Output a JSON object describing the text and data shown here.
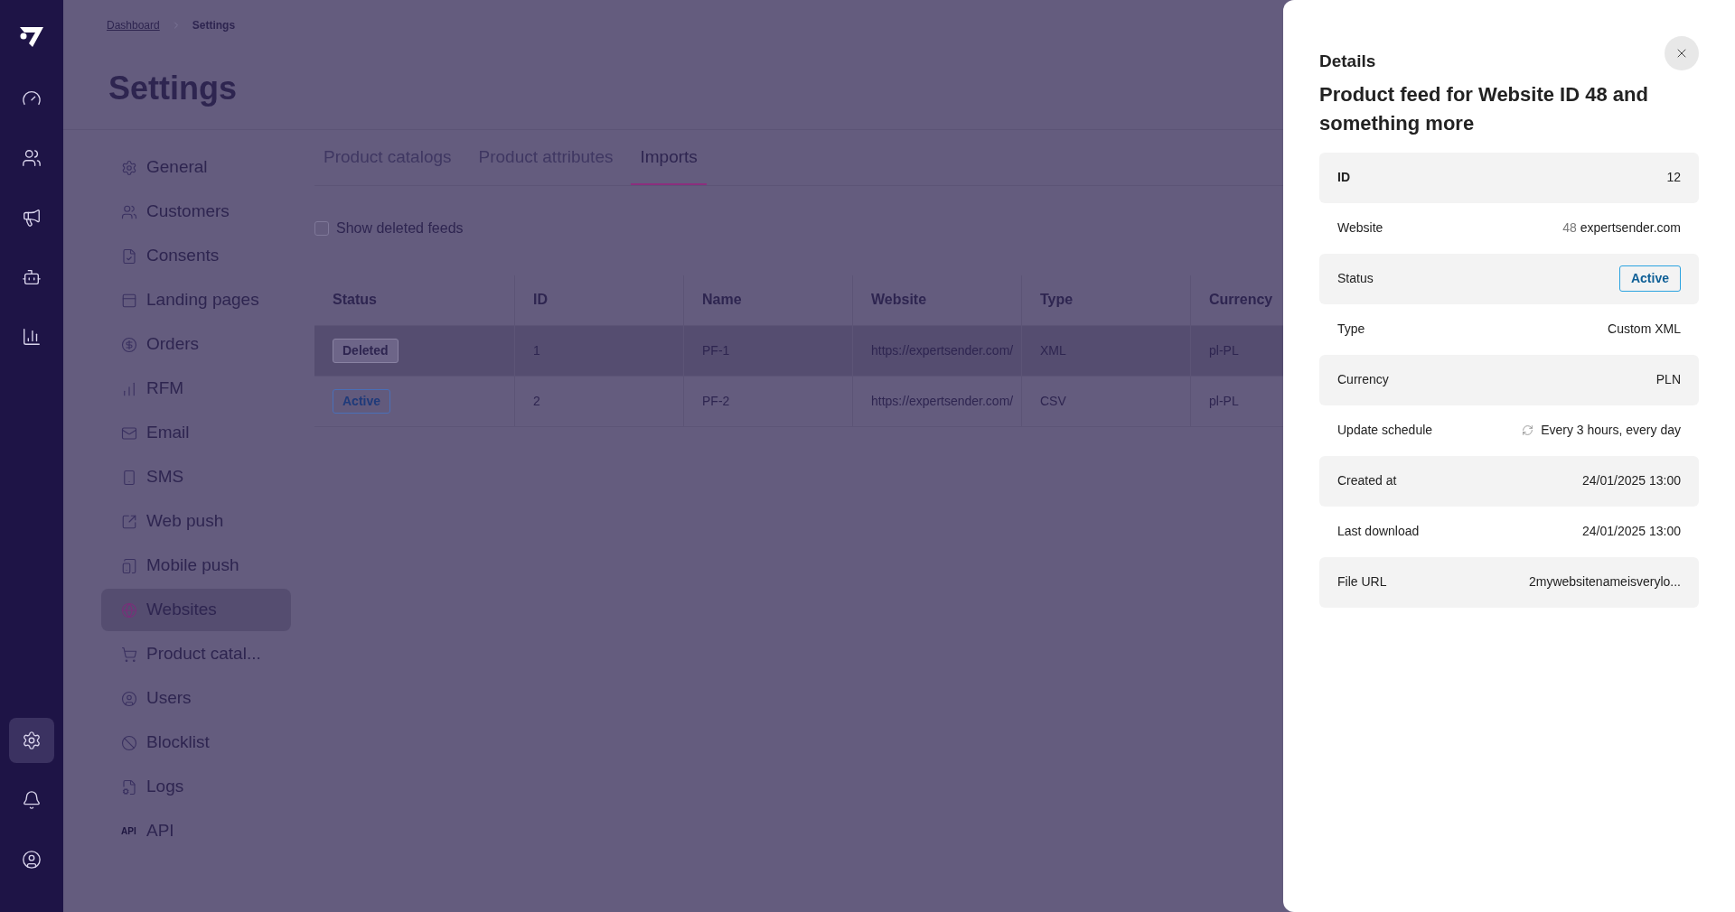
{
  "nav_rail": {
    "top_items": [
      {
        "selected": false
      },
      {
        "selected": false
      },
      {
        "selected": false
      },
      {
        "selected": false
      },
      {
        "selected": false
      }
    ],
    "bottom_items": [
      {
        "selected": true
      },
      {
        "selected": false
      },
      {
        "selected": false
      }
    ]
  },
  "breadcrumb": [
    "Dashboard",
    "Settings"
  ],
  "page_title": "Settings",
  "settings_menu": [
    {
      "label": "General",
      "selected": false
    },
    {
      "label": "Customers",
      "selected": false
    },
    {
      "label": "Consents",
      "selected": false
    },
    {
      "label": "Landing pages",
      "selected": false
    },
    {
      "label": "Orders",
      "selected": false
    },
    {
      "label": "RFM",
      "selected": false
    },
    {
      "label": "Email",
      "selected": false
    },
    {
      "label": "SMS",
      "selected": false
    },
    {
      "label": "Web push",
      "selected": false
    },
    {
      "label": "Mobile push",
      "selected": false
    },
    {
      "label": "Websites",
      "selected": true
    },
    {
      "label": "Product catal...",
      "selected": false
    },
    {
      "label": "Users",
      "selected": false
    },
    {
      "label": "Blocklist",
      "selected": false
    },
    {
      "label": "Logs",
      "selected": false
    },
    {
      "label": "API",
      "selected": false,
      "icon_text": "API"
    }
  ],
  "tabs": [
    {
      "label": "Product catalogs",
      "selected": false
    },
    {
      "label": "Product attributes",
      "selected": false
    },
    {
      "label": "Imports",
      "selected": true
    }
  ],
  "show_deleted": {
    "label": "Show deleted feeds",
    "checked": false
  },
  "table": {
    "columns": [
      "Status",
      "ID",
      "Name",
      "Website",
      "Type",
      "Currency"
    ],
    "rows": [
      {
        "highlighted": true,
        "cells": [
          {
            "kind": "deleted",
            "text": "Deleted"
          },
          {
            "kind": "text",
            "text": "1"
          },
          {
            "kind": "text",
            "text": "PF-1"
          },
          {
            "kind": "text",
            "text": "https://expertsender.com/"
          },
          {
            "kind": "text",
            "text": "XML"
          },
          {
            "kind": "text",
            "text": "pl-PL"
          }
        ]
      },
      {
        "highlighted": false,
        "cells": [
          {
            "kind": "active",
            "text": "Active"
          },
          {
            "kind": "text",
            "text": "2"
          },
          {
            "kind": "text",
            "text": "PF-2"
          },
          {
            "kind": "text",
            "text": "https://expertsender.com/"
          },
          {
            "kind": "text",
            "text": "CSV"
          },
          {
            "kind": "text",
            "text": "pl-PL"
          }
        ]
      }
    ]
  },
  "details": {
    "heading": "Details",
    "title": "Product feed for Website ID 48 and something more",
    "rows": [
      {
        "kind": "bold",
        "label": "ID",
        "value": "12"
      },
      {
        "kind": "text",
        "label": "Website",
        "prefix": "48",
        "value": "expertsender.com"
      },
      {
        "kind": "badge",
        "label": "Status",
        "value": "Active"
      },
      {
        "kind": "text",
        "label": "Type",
        "value": "Custom XML"
      },
      {
        "kind": "text",
        "label": "Currency",
        "value": "PLN"
      },
      {
        "kind": "schedule",
        "label": "Update schedule",
        "value": "Every 3 hours, every day"
      },
      {
        "kind": "text",
        "label": "Created at",
        "value": "24/01/2025 13:00"
      },
      {
        "kind": "text",
        "label": "Last download",
        "value": "24/01/2025 13:00"
      },
      {
        "kind": "text",
        "label": "File URL",
        "value": "2mywebsitenameisverylo..."
      }
    ]
  }
}
